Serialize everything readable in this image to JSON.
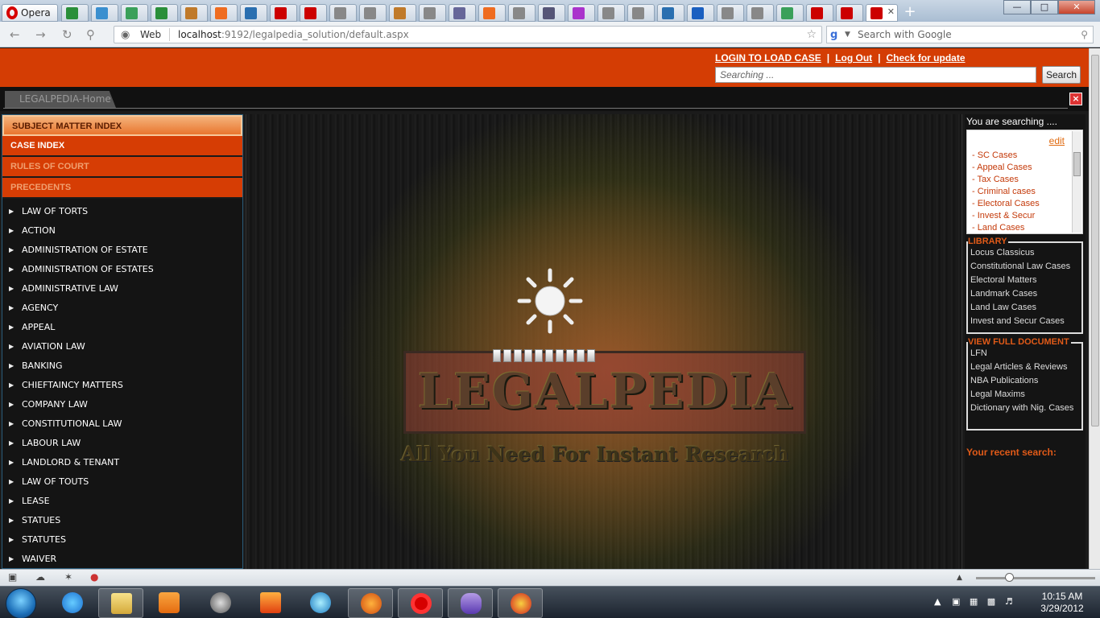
{
  "browser": {
    "menu_label": "Opera",
    "tab_count_shown": 30,
    "address_prefix": "Web",
    "url_host": "localhost",
    "url_rest": ":9192/legalpedia_solution/default.aspx",
    "search_placeholder": "Search with Google"
  },
  "header": {
    "links": [
      "LOGIN TO LOAD CASE",
      "Log Out",
      "Check for update"
    ],
    "search_placeholder": "Searching ...",
    "search_button": "Search"
  },
  "tabs": {
    "home": "LEGALPEDIA-Home",
    "close_glyph": "×"
  },
  "left": {
    "categories": [
      "SUBJECT MATTER INDEX",
      "CASE INDEX",
      "RULES OF COURT",
      "PRECEDENTS"
    ],
    "subjects": [
      " LAW OF TORTS",
      "ACTION",
      "ADMINISTRATION OF ESTATE",
      "ADMINISTRATION OF ESTATES",
      "ADMINISTRATIVE LAW",
      "AGENCY",
      "APPEAL",
      "AVIATION LAW",
      "BANKING",
      "CHIEFTAINCY MATTERS",
      "COMPANY LAW",
      "CONSTITUTIONAL LAW",
      "LABOUR LAW",
      "LANDLORD & TENANT",
      "LAW OF TOUTS",
      "LEASE",
      "STATUES",
      "STATUTES",
      "WAIVER"
    ]
  },
  "center": {
    "logo": "LEGALPEDIA",
    "tagline": "All You Need For Instant Research",
    "progress_segments": 10
  },
  "right": {
    "you_are_searching": "You are searching ....",
    "edit": "edit",
    "search_categories": [
      "- SC Cases",
      "- Appeal Cases",
      "- Tax Cases",
      "- Criminal cases",
      "- Electoral Cases",
      "- Invest & Secur",
      "- Land Cases"
    ],
    "library_title": "LIBRARY",
    "library_items": [
      "Locus Classicus",
      "Constitutional Law Cases",
      "Electoral Matters",
      "Landmark Cases",
      "Land Law Cases",
      "Invest and Secur Cases"
    ],
    "vfd_title": "VIEW FULL DOCUMENT",
    "vfd_items": [
      "LFN",
      "Legal Articles & Reviews",
      "NBA Publications",
      "Legal Maxims",
      "Dictionary with Nig. Cases"
    ],
    "recent_label": "Your recent search:"
  },
  "taskbar": {
    "time": "10:15 AM",
    "date": "3/29/2012"
  },
  "colors": {
    "brand_orange": "#d43d04",
    "accent_text": "#e05a18"
  }
}
